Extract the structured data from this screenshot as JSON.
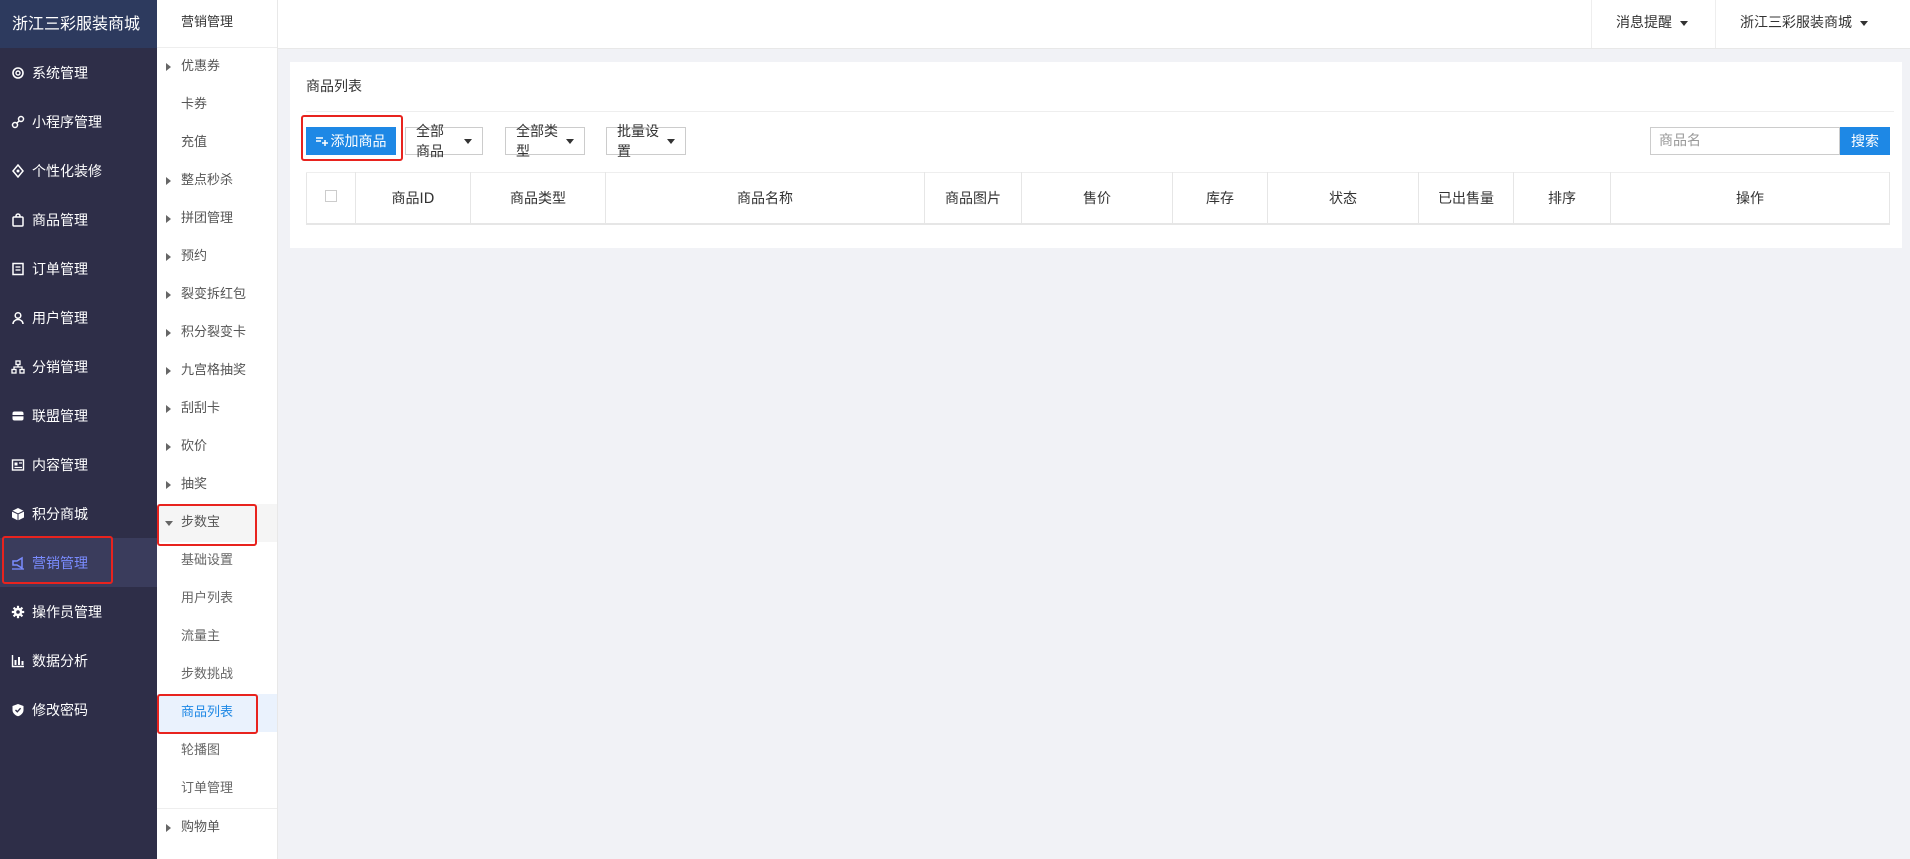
{
  "brand": {
    "title": "浙江三彩服装商城"
  },
  "sidebar": {
    "items": [
      {
        "label": "系统管理",
        "icon": "gear-outline-icon"
      },
      {
        "label": "小程序管理",
        "icon": "miniprogram-icon"
      },
      {
        "label": "个性化装修",
        "icon": "decoration-icon"
      },
      {
        "label": "商品管理",
        "icon": "bag-icon"
      },
      {
        "label": "订单管理",
        "icon": "order-icon"
      },
      {
        "label": "用户管理",
        "icon": "user-icon"
      },
      {
        "label": "分销管理",
        "icon": "hierarchy-icon"
      },
      {
        "label": "联盟管理",
        "icon": "alliance-icon"
      },
      {
        "label": "内容管理",
        "icon": "content-icon"
      },
      {
        "label": "积分商城",
        "icon": "cube-icon"
      },
      {
        "label": "营销管理",
        "icon": "marketing-icon",
        "active": true
      },
      {
        "label": "操作员管理",
        "icon": "gear-icon"
      },
      {
        "label": "数据分析",
        "icon": "chart-icon"
      },
      {
        "label": "修改密码",
        "icon": "shield-icon"
      }
    ]
  },
  "submenu": {
    "title": "营销管理",
    "items": [
      {
        "label": "优惠券",
        "caret": "right"
      },
      {
        "label": "卡券"
      },
      {
        "label": "充值"
      },
      {
        "label": "整点秒杀",
        "caret": "right"
      },
      {
        "label": "拼团管理",
        "caret": "right"
      },
      {
        "label": "预约",
        "caret": "right"
      },
      {
        "label": "裂变拆红包",
        "caret": "right"
      },
      {
        "label": "积分裂变卡",
        "caret": "right"
      },
      {
        "label": "九宫格抽奖",
        "caret": "right"
      },
      {
        "label": "刮刮卡",
        "caret": "right"
      },
      {
        "label": "砍价",
        "caret": "right"
      },
      {
        "label": "抽奖",
        "caret": "right"
      },
      {
        "label": "步数宝",
        "caret": "down"
      },
      {
        "label": "基础设置",
        "child": true
      },
      {
        "label": "用户列表",
        "child": true
      },
      {
        "label": "流量主",
        "child": true
      },
      {
        "label": "步数挑战",
        "child": true
      },
      {
        "label": "商品列表",
        "child": true,
        "current": true
      },
      {
        "label": "轮播图",
        "child": true
      },
      {
        "label": "订单管理",
        "child": true
      },
      {
        "label": "购物单",
        "caret": "right"
      }
    ]
  },
  "header": {
    "messages_label": "消息提醒",
    "store_label": "浙江三彩服装商城"
  },
  "main": {
    "title": "商品列表",
    "add_button": "添加商品",
    "filters": [
      "全部商品",
      "全部类型",
      "批量设置"
    ],
    "search_placeholder": "商品名",
    "search_button": "搜索",
    "columns": [
      "商品ID",
      "商品类型",
      "商品名称",
      "商品图片",
      "售价",
      "库存",
      "状态",
      "已出售量",
      "排序",
      "操作"
    ]
  },
  "colors": {
    "sidebar_bg": "#2e2e48",
    "brand_bg": "#2d3a5e",
    "accent": "#1e88e5",
    "active_text": "#7a8cff",
    "highlight_border": "#e8231e"
  }
}
